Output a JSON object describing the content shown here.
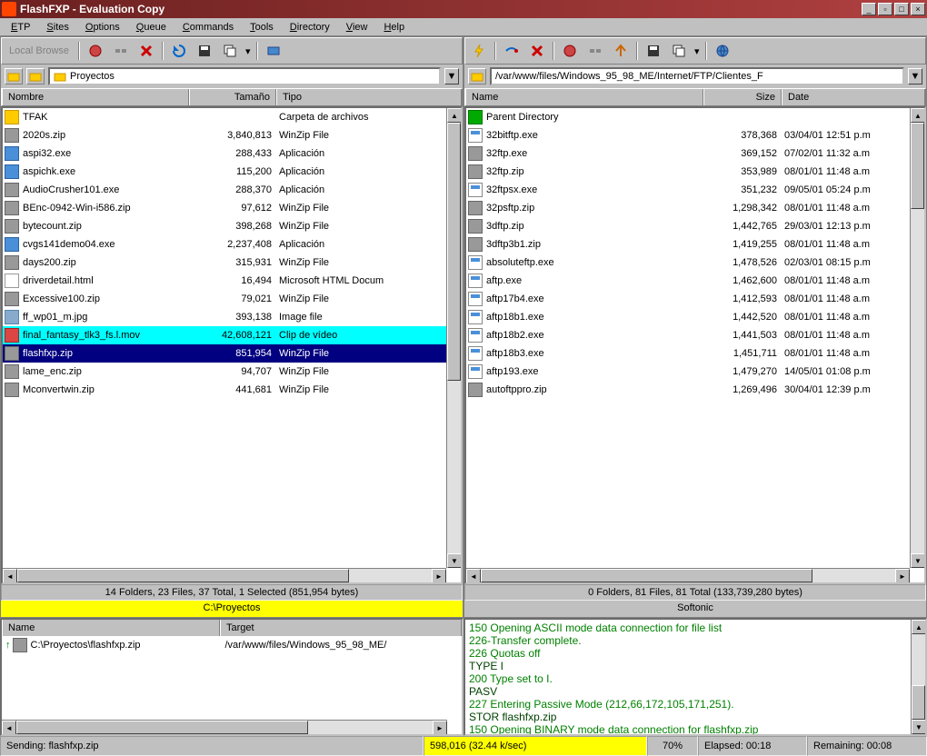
{
  "title": "FlashFXP - Evaluation Copy",
  "menu": [
    "ETP",
    "Sites",
    "Options",
    "Queue",
    "Commands",
    "Tools",
    "Directory",
    "View",
    "Help"
  ],
  "left": {
    "browse_label": "Local Browse",
    "path": "Proyectos",
    "columns": [
      "Nombre",
      "Tamaño",
      "Tipo"
    ],
    "files": [
      {
        "icon": "folder",
        "name": "TFAK",
        "size": "",
        "type": "Carpeta de archivos"
      },
      {
        "icon": "zip",
        "name": "2020s.zip",
        "size": "3,840,813",
        "type": "WinZip File"
      },
      {
        "icon": "exe",
        "name": "aspi32.exe",
        "size": "288,433",
        "type": "Aplicación"
      },
      {
        "icon": "exe",
        "name": "aspichk.exe",
        "size": "115,200",
        "type": "Aplicación"
      },
      {
        "icon": "zip",
        "name": "AudioCrusher101.exe",
        "size": "288,370",
        "type": "Aplicación"
      },
      {
        "icon": "zip",
        "name": "BEnc-0942-Win-i586.zip",
        "size": "97,612",
        "type": "WinZip File"
      },
      {
        "icon": "zip",
        "name": "bytecount.zip",
        "size": "398,268",
        "type": "WinZip File"
      },
      {
        "icon": "exe",
        "name": "cvgs141demo04.exe",
        "size": "2,237,408",
        "type": "Aplicación"
      },
      {
        "icon": "zip",
        "name": "days200.zip",
        "size": "315,931",
        "type": "WinZip File"
      },
      {
        "icon": "html",
        "name": "driverdetail.html",
        "size": "16,494",
        "type": "Microsoft HTML Docum"
      },
      {
        "icon": "zip",
        "name": "Excessive100.zip",
        "size": "79,021",
        "type": "WinZip File"
      },
      {
        "icon": "img",
        "name": "ff_wp01_m.jpg",
        "size": "393,138",
        "type": "Image file"
      },
      {
        "icon": "mov",
        "name": "final_fantasy_tlk3_fs.l.mov",
        "size": "42,608,121",
        "type": "Clip de vídeo",
        "hl": "cyan"
      },
      {
        "icon": "zip",
        "name": "flashfxp.zip",
        "size": "851,954",
        "type": "WinZip File",
        "selected": true
      },
      {
        "icon": "zip",
        "name": "lame_enc.zip",
        "size": "94,707",
        "type": "WinZip File"
      },
      {
        "icon": "zip",
        "name": "Mconvertwin.zip",
        "size": "441,681",
        "type": "WinZip File"
      }
    ],
    "status": "14 Folders, 23 Files, 37 Total, 1 Selected (851,954 bytes)",
    "pathline": "C:\\Proyectos"
  },
  "right": {
    "path": "/var/www/files/Windows_95_98_ME/Internet/FTP/Clientes_F",
    "columns": [
      "Name",
      "Size",
      "Date"
    ],
    "files": [
      {
        "icon": "parent",
        "name": "Parent Directory",
        "size": "",
        "date": ""
      },
      {
        "icon": "app",
        "name": "32bitftp.exe",
        "size": "378,368",
        "date": "03/04/01 12:51 p.m"
      },
      {
        "icon": "zip",
        "name": "32ftp.exe",
        "size": "369,152",
        "date": "07/02/01 11:32 a.m"
      },
      {
        "icon": "zip",
        "name": "32ftp.zip",
        "size": "353,989",
        "date": "08/01/01 11:48 a.m"
      },
      {
        "icon": "app",
        "name": "32ftpsx.exe",
        "size": "351,232",
        "date": "09/05/01 05:24 p.m"
      },
      {
        "icon": "zip",
        "name": "32psftp.zip",
        "size": "1,298,342",
        "date": "08/01/01 11:48 a.m"
      },
      {
        "icon": "zip",
        "name": "3dftp.zip",
        "size": "1,442,765",
        "date": "29/03/01 12:13 p.m"
      },
      {
        "icon": "zip",
        "name": "3dftp3b1.zip",
        "size": "1,419,255",
        "date": "08/01/01 11:48 a.m"
      },
      {
        "icon": "app",
        "name": "absoluteftp.exe",
        "size": "1,478,526",
        "date": "02/03/01 08:15 p.m"
      },
      {
        "icon": "app",
        "name": "aftp.exe",
        "size": "1,462,600",
        "date": "08/01/01 11:48 a.m"
      },
      {
        "icon": "app",
        "name": "aftp17b4.exe",
        "size": "1,412,593",
        "date": "08/01/01 11:48 a.m"
      },
      {
        "icon": "app",
        "name": "aftp18b1.exe",
        "size": "1,442,520",
        "date": "08/01/01 11:48 a.m"
      },
      {
        "icon": "app",
        "name": "aftp18b2.exe",
        "size": "1,441,503",
        "date": "08/01/01 11:48 a.m"
      },
      {
        "icon": "app",
        "name": "aftp18b3.exe",
        "size": "1,451,711",
        "date": "08/01/01 11:48 a.m"
      },
      {
        "icon": "app",
        "name": "aftp193.exe",
        "size": "1,479,270",
        "date": "14/05/01 01:08 p.m"
      },
      {
        "icon": "zip",
        "name": "autoftppro.zip",
        "size": "1,269,496",
        "date": "30/04/01 12:39 p.m"
      }
    ],
    "status": "0 Folders, 81 Files, 81 Total (133,739,280 bytes)",
    "pathline": "Softonic"
  },
  "queue": {
    "columns": [
      "Name",
      "Target"
    ],
    "item_name": "C:\\Proyectos\\flashfxp.zip",
    "item_target": "/var/www/files/Windows_95_98_ME/"
  },
  "log": [
    {
      "cls": "green",
      "text": "150 Opening ASCII mode data connection for file list"
    },
    {
      "cls": "green",
      "text": "226-Transfer complete."
    },
    {
      "cls": "green",
      "text": "226 Quotas off"
    },
    {
      "cls": "dark",
      "text": "TYPE I"
    },
    {
      "cls": "green",
      "text": "200 Type set to I."
    },
    {
      "cls": "dark",
      "text": "PASV"
    },
    {
      "cls": "green",
      "text": "227 Entering Passive Mode (212,66,172,105,171,251)."
    },
    {
      "cls": "dark",
      "text": "STOR flashfxp.zip"
    },
    {
      "cls": "green",
      "text": "150 Opening BINARY mode data connection for flashfxp.zip"
    }
  ],
  "bottom": {
    "sending": "Sending: flashfxp.zip",
    "bytes": "598,016 (32.44 k/sec)",
    "percent": "70%",
    "elapsed": "Elapsed: 00:18",
    "remaining": "Remaining: 00:08"
  }
}
